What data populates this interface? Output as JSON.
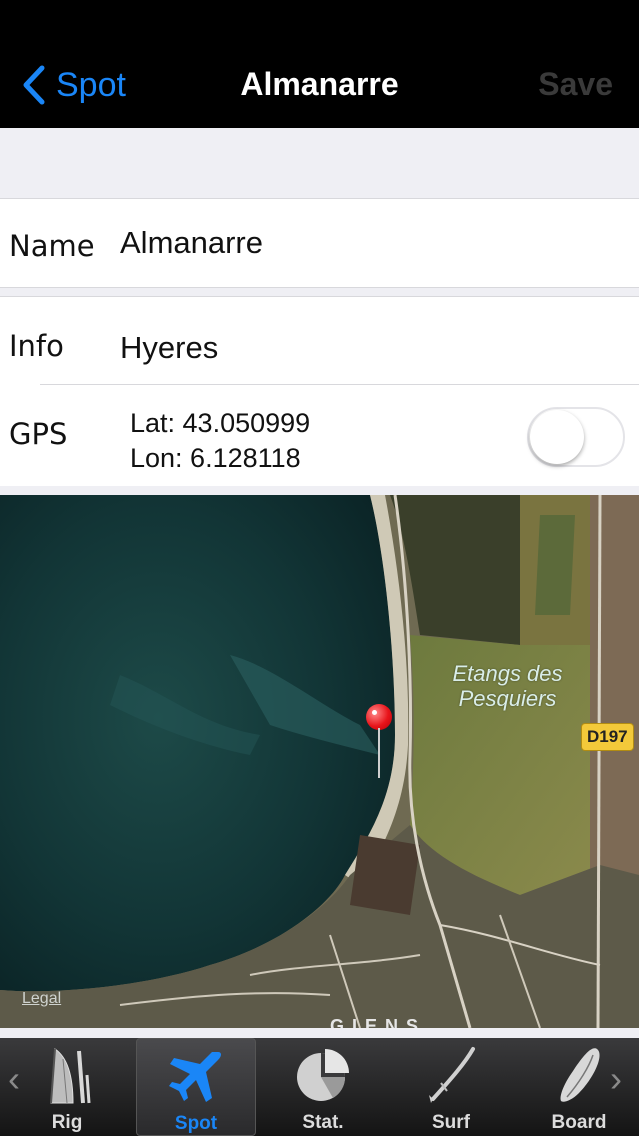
{
  "nav": {
    "back_label": "Spot",
    "title": "Almanarre",
    "save_label": "Save"
  },
  "form": {
    "name_label": "Name",
    "name_value": "Almanarre",
    "info_label": "Info",
    "info_value": "Hyeres",
    "gps_label": "GPS",
    "lat_text": "Lat: 43.050999",
    "lon_text": "Lon: 6.128118",
    "gps_toggle_on": false
  },
  "map": {
    "place_label_line1": "Etangs des",
    "place_label_line2": "Pesquiers",
    "road_label": "D197",
    "legal_label": "Legal",
    "bottom_label": "GIENS"
  },
  "tabs": [
    {
      "label": "Rig",
      "icon": "sail-icon",
      "active": false
    },
    {
      "label": "Spot",
      "icon": "airplane-icon",
      "active": true
    },
    {
      "label": "Stat.",
      "icon": "pie-chart-icon",
      "active": false
    },
    {
      "label": "Surf",
      "icon": "surf-icon",
      "active": false
    },
    {
      "label": "Board",
      "icon": "board-icon",
      "active": false
    }
  ],
  "colors": {
    "accent": "#1a86f7",
    "nav_bg": "#000000",
    "pin": "#e8141a"
  }
}
